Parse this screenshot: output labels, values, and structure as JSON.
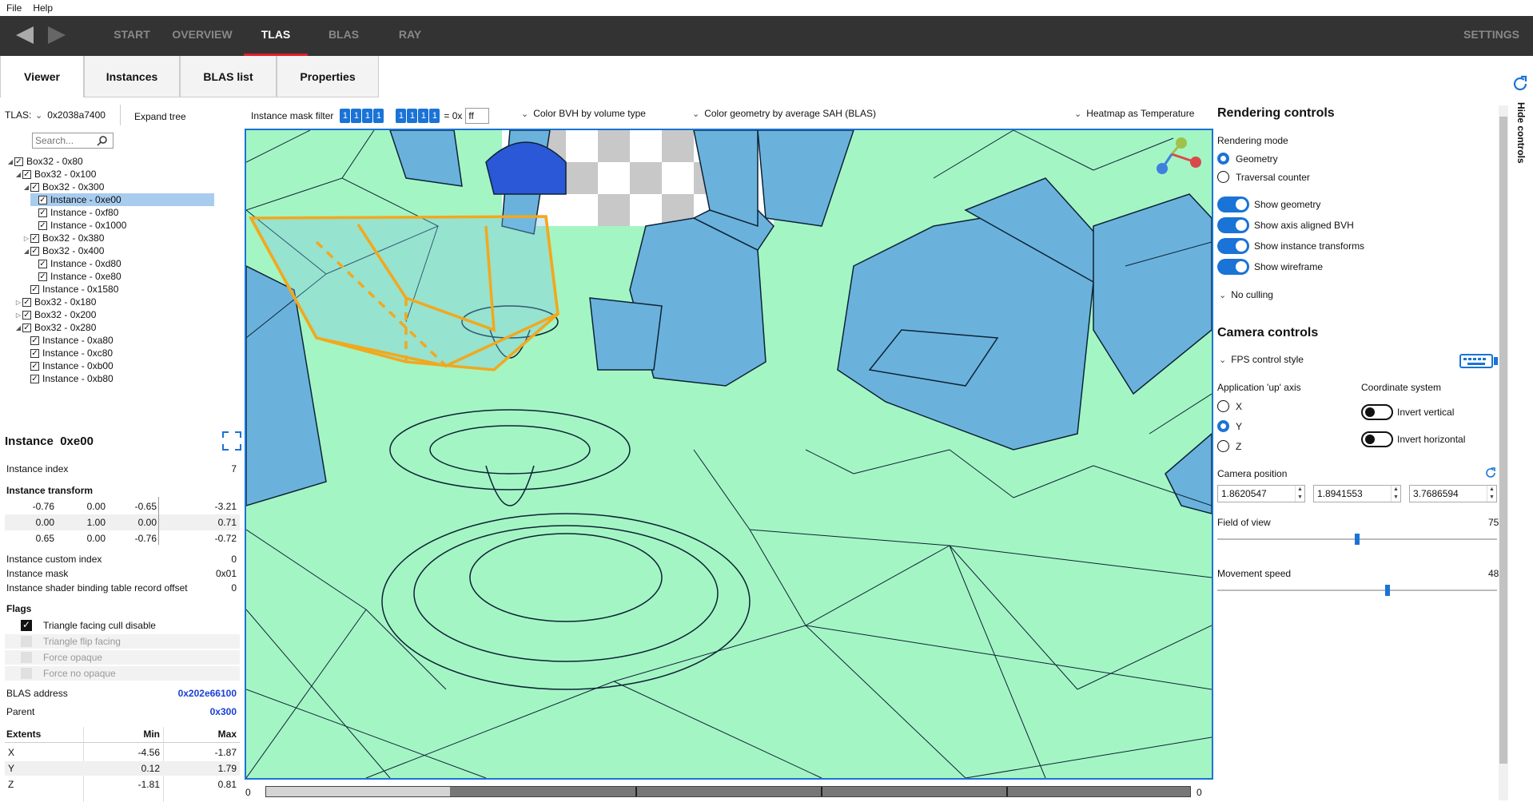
{
  "menu": {
    "file": "File",
    "help": "Help"
  },
  "nav": {
    "tabs": [
      "START",
      "OVERVIEW",
      "TLAS",
      "BLAS",
      "RAY"
    ],
    "active": "TLAS",
    "settings": "SETTINGS"
  },
  "subtabs": [
    "Viewer",
    "Instances",
    "BLAS list",
    "Properties"
  ],
  "tlas": {
    "label": "TLAS:",
    "address": "0x2038a7400",
    "expand_tree": "Expand tree",
    "search_placeholder": "Search..."
  },
  "tree": [
    {
      "label": "Box32 - 0x80",
      "level": 0,
      "expanded": true
    },
    {
      "label": "Box32 - 0x100",
      "level": 1,
      "expanded": true
    },
    {
      "label": "Box32 - 0x300",
      "level": 2,
      "expanded": true
    },
    {
      "label": "Instance - 0xe00",
      "level": 3,
      "selected": true
    },
    {
      "label": "Instance - 0xf80",
      "level": 3
    },
    {
      "label": "Instance - 0x1000",
      "level": 3
    },
    {
      "label": "Box32 - 0x380",
      "level": 2,
      "expanded": false
    },
    {
      "label": "Box32 - 0x400",
      "level": 2,
      "expanded": true
    },
    {
      "label": "Instance - 0xd80",
      "level": 3
    },
    {
      "label": "Instance - 0xe80",
      "level": 3
    },
    {
      "label": "Instance - 0x1580",
      "level": 2
    },
    {
      "label": "Box32 - 0x180",
      "level": 1,
      "expanded": false
    },
    {
      "label": "Box32 - 0x200",
      "level": 1,
      "expanded": false
    },
    {
      "label": "Box32 - 0x280",
      "level": 1,
      "expanded": true
    },
    {
      "label": "Instance - 0xa80",
      "level": 2
    },
    {
      "label": "Instance - 0xc80",
      "level": 2
    },
    {
      "label": "Instance - 0xb00",
      "level": 2
    },
    {
      "label": "Instance - 0xb80",
      "level": 2
    }
  ],
  "instance": {
    "title": "Instance",
    "id": "0xe00",
    "index_label": "Instance index",
    "index_value": "7",
    "transform_label": "Instance transform",
    "transform": [
      [
        "-0.76",
        "0.00",
        "-0.65",
        "-3.21"
      ],
      [
        "0.00",
        "1.00",
        "0.00",
        "0.71"
      ],
      [
        "0.65",
        "0.00",
        "-0.76",
        "-0.72"
      ]
    ],
    "custom_index_label": "Instance custom index",
    "custom_index_value": "0",
    "mask_label": "Instance mask",
    "mask_value": "0x01",
    "sbt_label": "Instance shader binding table record offset",
    "sbt_value": "0",
    "flags_label": "Flags",
    "flags": [
      {
        "label": "Triangle facing cull disable",
        "checked": true,
        "enabled": true
      },
      {
        "label": "Triangle flip facing",
        "checked": false,
        "enabled": false
      },
      {
        "label": "Force opaque",
        "checked": false,
        "enabled": false
      },
      {
        "label": "Force no opaque",
        "checked": false,
        "enabled": false
      }
    ],
    "blas_address_label": "BLAS address",
    "blas_address_value": "0x202e66100",
    "parent_label": "Parent",
    "parent_value": "0x300",
    "extents_headers": [
      "Extents",
      "Min",
      "Max"
    ],
    "extents": [
      [
        "X",
        "-4.56",
        "-1.87"
      ],
      [
        "Y",
        "0.12",
        "1.79"
      ],
      [
        "Z",
        "-1.81",
        "0.81"
      ]
    ]
  },
  "viewer_toolbar": {
    "mask_filter_label": "Instance mask filter",
    "mask_bits_a": [
      "1",
      "1",
      "1",
      "1"
    ],
    "mask_bits_b": [
      "1",
      "1",
      "1",
      "1"
    ],
    "mask_eq": "= 0x",
    "mask_value": "ff",
    "color_bvh": "Color BVH by volume type",
    "color_geometry": "Color geometry by average SAH (BLAS)",
    "heatmap": "Heatmap as Temperature"
  },
  "timeline": {
    "start": "0",
    "end": "0"
  },
  "rendering": {
    "title": "Rendering controls",
    "mode_label": "Rendering mode",
    "modes": [
      "Geometry",
      "Traversal counter"
    ],
    "mode_selected": "Geometry",
    "toggles": [
      "Show geometry",
      "Show axis aligned BVH",
      "Show instance transforms",
      "Show wireframe"
    ],
    "culling": "No culling"
  },
  "camera": {
    "title": "Camera controls",
    "control_style": "FPS control style",
    "up_axis_label": "Application 'up' axis",
    "axes": [
      "X",
      "Y",
      "Z"
    ],
    "axis_selected": "Y",
    "coord_label": "Coordinate system",
    "invert_vertical": "Invert vertical",
    "invert_horizontal": "Invert horizontal",
    "position_label": "Camera position",
    "position": [
      "1.8620547",
      "1.8941553",
      "3.7686594"
    ],
    "fov_label": "Field of view",
    "fov_value": "75",
    "speed_label": "Movement speed",
    "speed_value": "48"
  },
  "hide_controls": "Hide controls",
  "colors": {
    "accent": "#1a73d6",
    "nav_bg": "#333333",
    "active_tab_underline": "#e01e2d",
    "ground": "#a4f5c4",
    "geometry": "#6ab2dc",
    "bvh": "#f2a81d"
  }
}
